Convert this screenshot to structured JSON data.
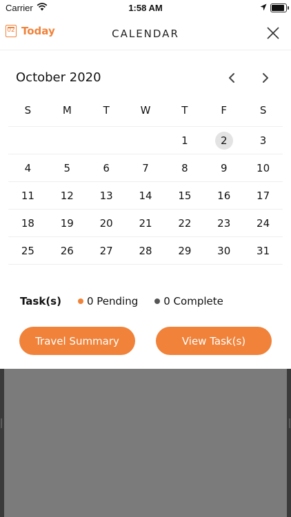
{
  "status_bar": {
    "carrier": "Carrier",
    "time": "1:58 AM"
  },
  "header": {
    "today_icon_text": "02",
    "today_label": "Today",
    "title": "CALENDAR",
    "close_icon": "close-icon"
  },
  "calendar": {
    "month_label": "October 2020",
    "weekdays": [
      "S",
      "M",
      "T",
      "W",
      "T",
      "F",
      "S"
    ],
    "weeks": [
      [
        "",
        "",
        "",
        "",
        "1",
        "2",
        "3"
      ],
      [
        "4",
        "5",
        "6",
        "7",
        "8",
        "9",
        "10"
      ],
      [
        "11",
        "12",
        "13",
        "14",
        "15",
        "16",
        "17"
      ],
      [
        "18",
        "19",
        "20",
        "21",
        "22",
        "23",
        "24"
      ],
      [
        "25",
        "26",
        "27",
        "28",
        "29",
        "30",
        "31"
      ]
    ],
    "selected_day": "2"
  },
  "tasks": {
    "label": "Task(s)",
    "pending": "0 Pending",
    "complete": "0 Complete"
  },
  "buttons": {
    "travel_summary": "Travel Summary",
    "view_tasks": "View Task(s)"
  },
  "colors": {
    "accent": "#f0823a",
    "complete_dot": "#555555",
    "selected_day_bg": "#e3e3e3"
  }
}
